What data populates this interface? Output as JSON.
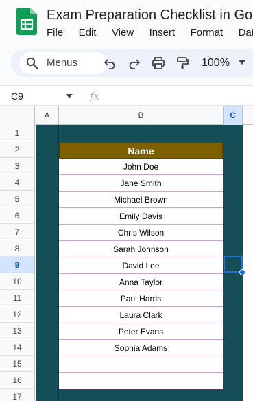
{
  "document": {
    "title": "Exam Preparation Checklist in Go"
  },
  "menu": [
    "File",
    "Edit",
    "View",
    "Insert",
    "Format",
    "Data"
  ],
  "toolbar": {
    "search_label": "Menus",
    "zoom": "100%",
    "icons": [
      "search-icon",
      "undo-icon",
      "redo-icon",
      "print-icon",
      "paint-format-icon",
      "zoom-caret-icon"
    ]
  },
  "formula_bar": {
    "name_box": "C9",
    "fx_label": "fx",
    "value": ""
  },
  "columns": [
    "A",
    "B",
    "C"
  ],
  "rows": [
    "1",
    "2",
    "3",
    "4",
    "5",
    "6",
    "7",
    "8",
    "9",
    "10",
    "11",
    "12",
    "13",
    "14",
    "15",
    "16",
    "17"
  ],
  "selected_cell": "C9",
  "table": {
    "header": "Name",
    "names": [
      "John Doe",
      "Jane Smith",
      "Michael Brown",
      "Emily Davis",
      "Chris Wilson",
      "Sarah Johnson",
      "David Lee",
      "Anna Taylor",
      "Paul Harris",
      "Laura Clark",
      "Peter Evans",
      "Sophia Adams",
      "",
      ""
    ]
  },
  "colors": {
    "header_fill": "#7f6000",
    "background_fill": "#164e58",
    "selection": "#1a73e8",
    "sheets_green": "#0f9d58"
  }
}
